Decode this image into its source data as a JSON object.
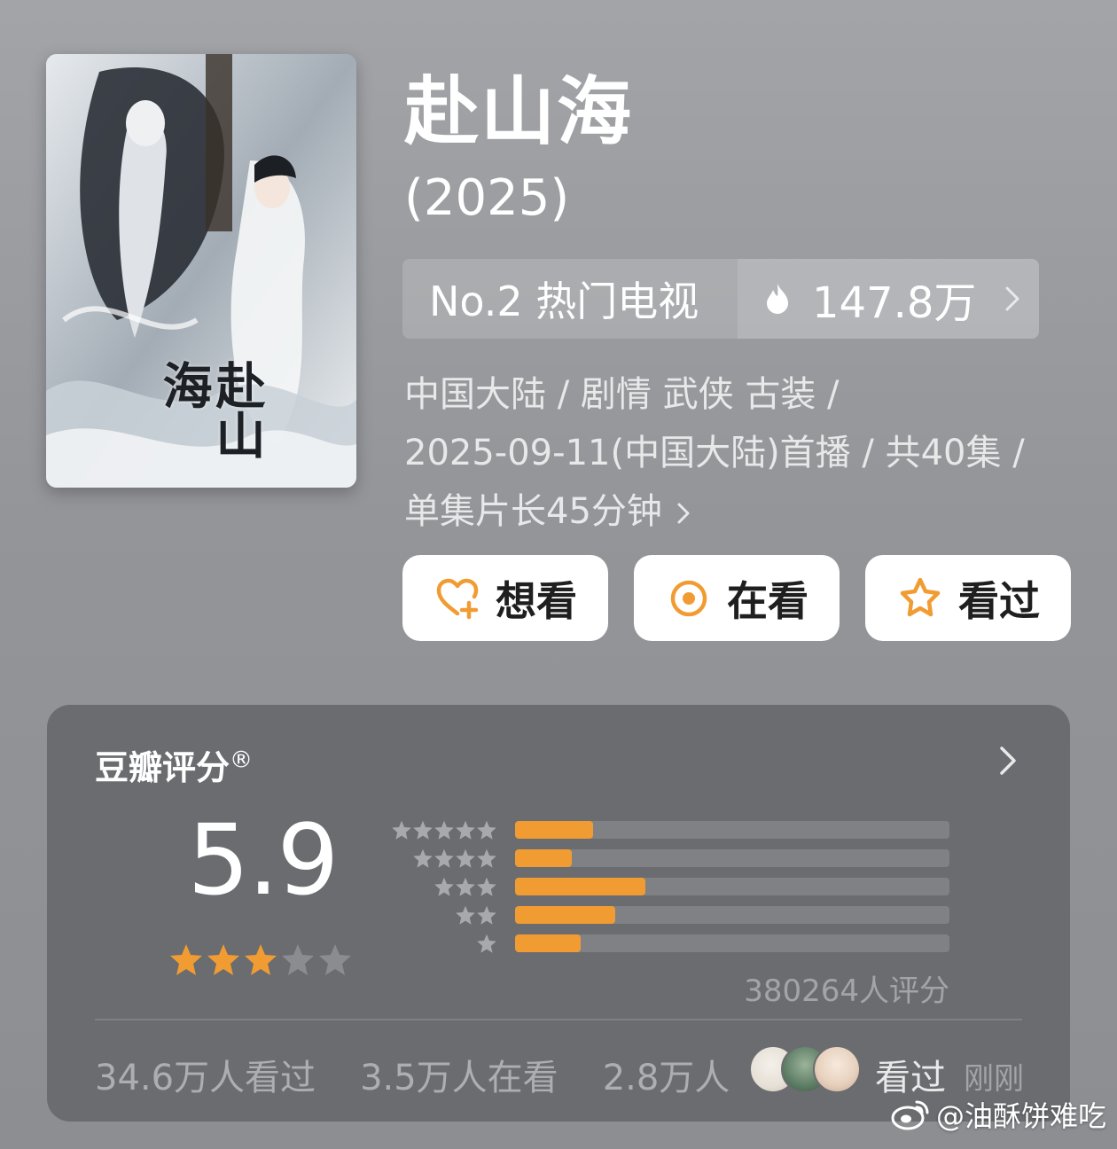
{
  "poster": {
    "calligraphy": "赴山海",
    "icon": "poster-image"
  },
  "title": "赴山海",
  "year": "(2025)",
  "rank": {
    "label": "No.2 热门电视",
    "heat": "147.8万",
    "icon": "fire-icon"
  },
  "meta": {
    "line1": "中国大陆 / 剧情 武侠 古装 /",
    "line2": "2025-09-11(中国大陆)首播 / 共40集 /",
    "line3": "单集片长45分钟"
  },
  "actions": [
    {
      "label": "想看",
      "icon": "heart-plus-icon"
    },
    {
      "label": "在看",
      "icon": "circle-dot-icon"
    },
    {
      "label": "看过",
      "icon": "star-outline-icon"
    }
  ],
  "rating": {
    "title": "豆瓣评分",
    "registered": "®",
    "score": "5.9",
    "stars_filled": 3,
    "stars_total": 5,
    "distribution": [
      {
        "stars": 5,
        "fraction": 0.18
      },
      {
        "stars": 4,
        "fraction": 0.13
      },
      {
        "stars": 3,
        "fraction": 0.3
      },
      {
        "stars": 2,
        "fraction": 0.23
      },
      {
        "stars": 1,
        "fraction": 0.15
      }
    ],
    "count": "380264人评分",
    "stats": {
      "watched": "34.6万人看过",
      "watching": "3.5万人在看",
      "want": "2.8万人"
    },
    "friends_action": "看过",
    "friends_time": "刚刚"
  },
  "colors": {
    "accent": "#f19c33",
    "card": "#6a6c70",
    "bar_track": "#7f8185"
  },
  "watermark": "@油酥饼难吃"
}
